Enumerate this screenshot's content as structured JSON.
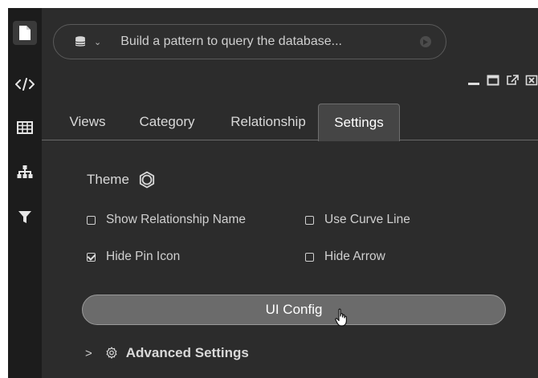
{
  "query": {
    "placeholder": "Build a pattern to query the database..."
  },
  "rail": [
    {
      "icon": "document-icon",
      "active": true
    },
    {
      "icon": "code-icon",
      "active": false
    },
    {
      "icon": "table-icon",
      "active": false
    },
    {
      "icon": "hierarchy-icon",
      "active": false
    },
    {
      "icon": "filter-icon",
      "active": false
    }
  ],
  "tabs": [
    {
      "label": "Views"
    },
    {
      "label": "Category"
    },
    {
      "label": "Relationship"
    },
    {
      "label": "Settings",
      "active": true
    }
  ],
  "settings": {
    "theme_label": "Theme",
    "options": [
      {
        "label": "Show Relationship Name",
        "checked": false
      },
      {
        "label": "Use Curve Line",
        "checked": false
      },
      {
        "label": "Hide Pin Icon",
        "checked": true
      },
      {
        "label": "Hide Arrow",
        "checked": false
      }
    ],
    "ui_config_label": "UI Config",
    "advanced_label": "Advanced Settings"
  },
  "colors": {
    "panel_bg": "#2c2c2c",
    "rail_bg": "#1c1c1c",
    "active_tab_bg": "#454545",
    "button_bg": "#6b6b6b"
  }
}
